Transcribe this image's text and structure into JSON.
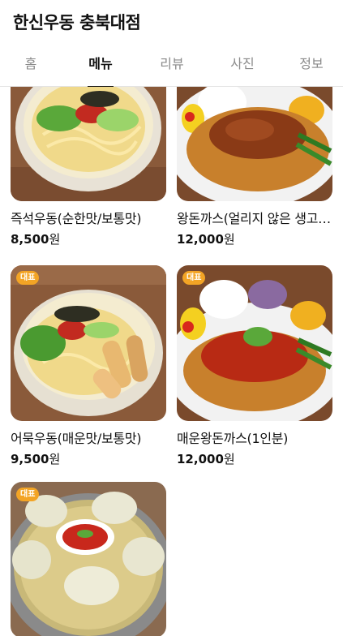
{
  "header": {
    "title": "한신우동 충북대점"
  },
  "tabs": [
    {
      "label": "홈",
      "active": false
    },
    {
      "label": "메뉴",
      "active": true
    },
    {
      "label": "리뷰",
      "active": false
    },
    {
      "label": "사진",
      "active": false
    },
    {
      "label": "정보",
      "active": false
    }
  ],
  "menu": [
    {
      "name": "즉석우동(순한맛/보통맛)",
      "price": "8,500",
      "unit": "원",
      "badge": "",
      "image": "udon-icon"
    },
    {
      "name": "왕돈까스(얼리지 않은 생고기)",
      "price": "12,000",
      "unit": "원",
      "badge": "",
      "image": "pork-cutlet-icon"
    },
    {
      "name": "어묵우동(매운맛/보통맛)",
      "price": "9,500",
      "unit": "원",
      "badge": "대표",
      "image": "fishcake-udon-icon"
    },
    {
      "name": "매운왕돈까스(1인분)",
      "price": "12,000",
      "unit": "원",
      "badge": "대표",
      "image": "spicy-pork-cutlet-icon"
    },
    {
      "name": "",
      "price": "",
      "unit": "",
      "badge": "대표",
      "image": "dumpling-icon"
    }
  ],
  "colors": {
    "badge": "#f3a425",
    "active_tab": "#111111",
    "inactive_tab": "#8a8a8a"
  }
}
